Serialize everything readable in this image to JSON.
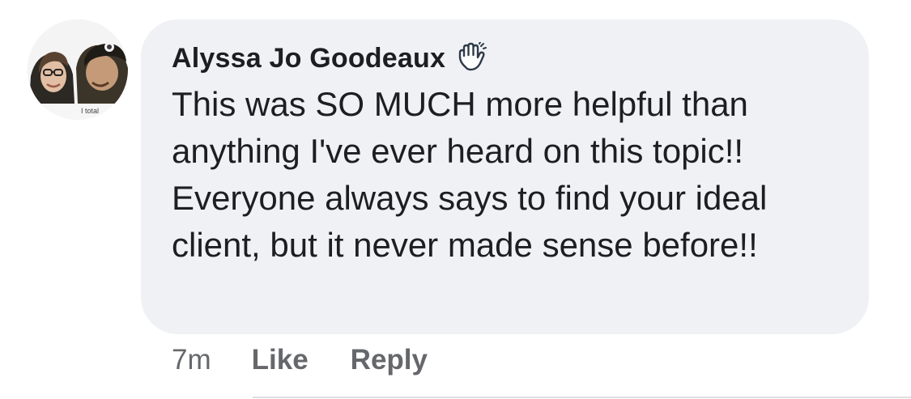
{
  "comment": {
    "author": "Alyssa Jo Goodeaux",
    "badge_icon": "waving-hand-icon",
    "text": "This was SO MUCH more helpful than anything I've ever heard on this topic!! Everyone always says to find your ideal client, but it never made sense before!!",
    "timestamp": "7m",
    "actions": {
      "like": "Like",
      "reply": "Reply"
    }
  },
  "avatar": {
    "caption": "I total"
  },
  "colors": {
    "bubble": "#f0f1f4",
    "text": "#1c1e21",
    "meta": "#65676b"
  }
}
